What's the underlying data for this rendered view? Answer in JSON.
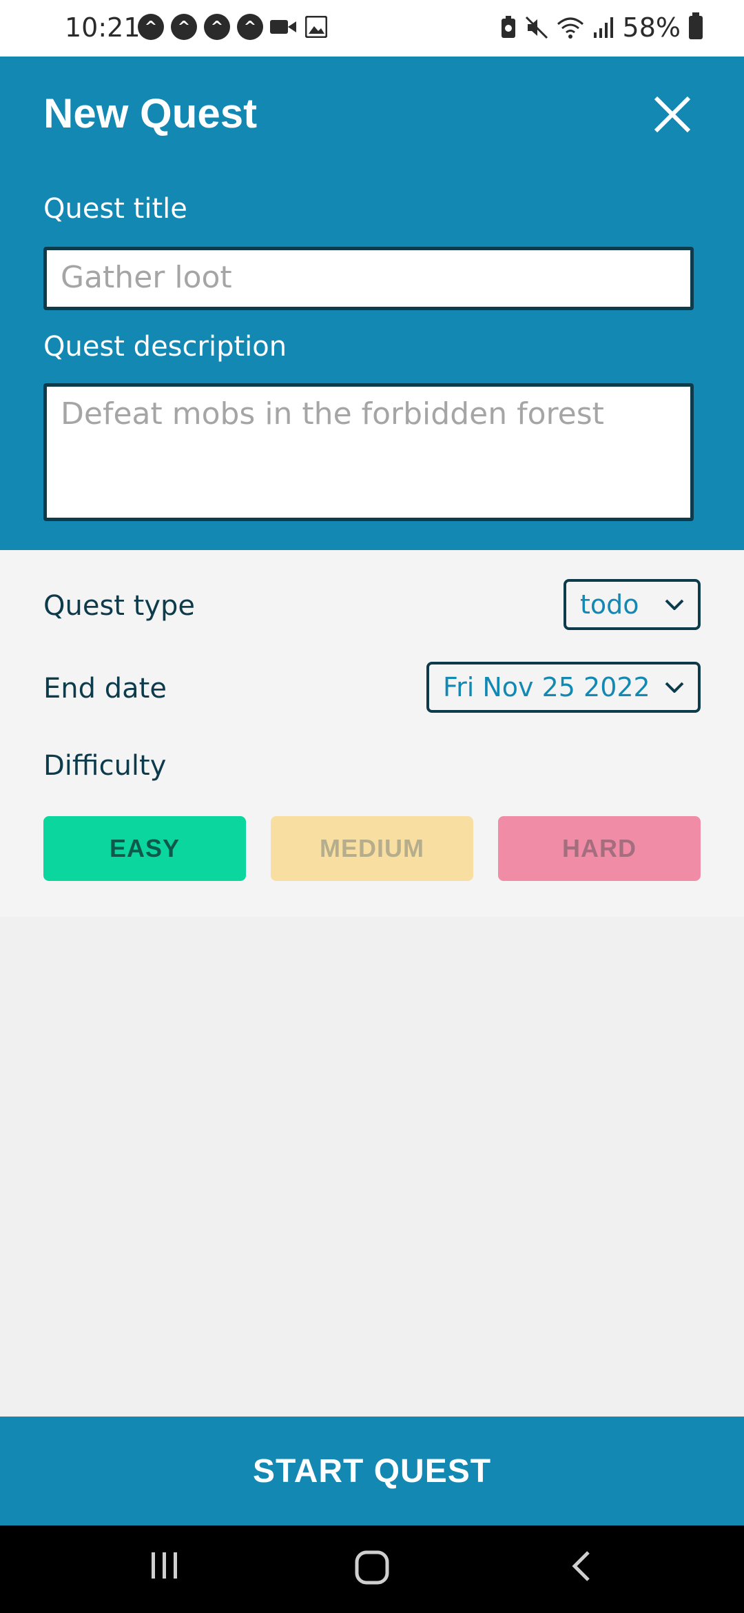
{
  "status_bar": {
    "time": "10:21",
    "left_icons": [
      "app-icon",
      "app-icon",
      "app-icon",
      "app-icon",
      "video-icon",
      "image-icon"
    ],
    "right_icons": [
      "battery-saver-icon",
      "mute-icon",
      "wifi-icon",
      "signal-icon"
    ],
    "battery": "58%"
  },
  "header": {
    "title": "New Quest",
    "close_icon": "close-icon",
    "title_label": "Quest title",
    "title_placeholder": "Gather loot",
    "description_label": "Quest description",
    "description_placeholder": "Defeat mobs in the forbidden forest"
  },
  "settings": {
    "quest_type_label": "Quest type",
    "quest_type_value": "todo",
    "end_date_label": "End date",
    "end_date_value": "Fri Nov 25 2022",
    "difficulty_label": "Difficulty",
    "difficulty_options": [
      {
        "label": "EASY",
        "bg": "#0ad69e",
        "color": "#0d5a4a"
      },
      {
        "label": "MEDIUM",
        "bg": "#f8dea1",
        "color": "#b5ad8b"
      },
      {
        "label": "HARD",
        "bg": "#f08ca6",
        "color": "#a46e7f"
      }
    ]
  },
  "footer": {
    "start_button": "START QUEST"
  },
  "colors": {
    "primary": "#1288b3",
    "dark": "#0d3b4c"
  }
}
